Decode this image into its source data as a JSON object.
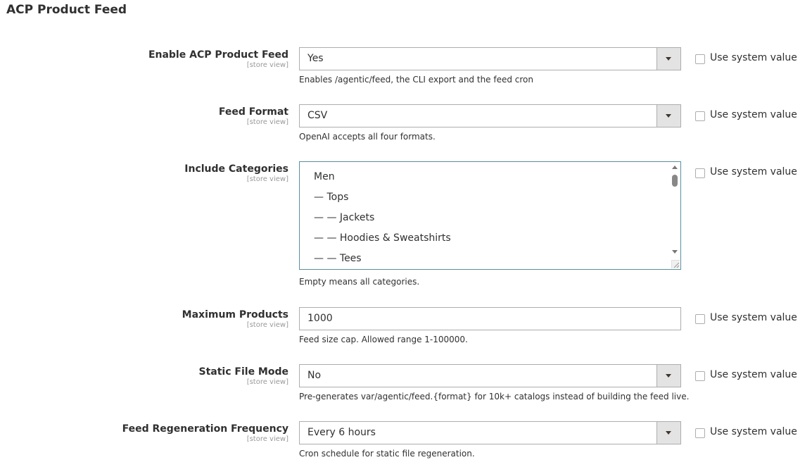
{
  "section": {
    "title": "ACP Product Feed"
  },
  "fields": {
    "enable": {
      "label": "Enable ACP Product Feed",
      "scope": "[store view]",
      "value": "Yes",
      "note": "Enables /agentic/feed, the CLI export and the feed cron",
      "use_system": "Use system value"
    },
    "format": {
      "label": "Feed Format",
      "scope": "[store view]",
      "value": "CSV",
      "note": "OpenAI accepts all four formats.",
      "use_system": "Use system value"
    },
    "categories": {
      "label": "Include Categories",
      "scope": "[store view]",
      "options": [
        "Men",
        "— Tops",
        "— — Jackets",
        "— — Hoodies & Sweatshirts",
        "— — Tees"
      ],
      "note": "Empty means all categories.",
      "use_system": "Use system value"
    },
    "max_products": {
      "label": "Maximum Products",
      "scope": "[store view]",
      "value": "1000",
      "note": "Feed size cap. Allowed range 1-100000.",
      "use_system": "Use system value"
    },
    "static_mode": {
      "label": "Static File Mode",
      "scope": "[store view]",
      "value": "No",
      "note": "Pre-generates var/agentic/feed.{format} for 10k+ catalogs instead of building the feed live.",
      "use_system": "Use system value"
    },
    "frequency": {
      "label": "Feed Regeneration Frequency",
      "scope": "[store view]",
      "value": "Every 6 hours",
      "note": "Cron schedule for static file regeneration.",
      "use_system": "Use system value"
    }
  }
}
